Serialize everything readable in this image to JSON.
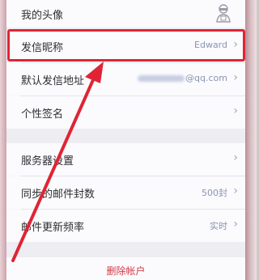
{
  "settings": {
    "avatar": {
      "label": "我的头像",
      "icon": "avatar-icon"
    },
    "sender_name": {
      "label": "发信昵称",
      "value": "Edward"
    },
    "default_address": {
      "label": "默认发信地址",
      "value": "@qq.com"
    },
    "signature": {
      "label": "个性签名"
    },
    "server": {
      "label": "服务器设置"
    },
    "sync_count": {
      "label": "同步的邮件封数",
      "value": "500封"
    },
    "update_freq": {
      "label": "邮件更新频率",
      "value": "实时"
    },
    "delete_account": {
      "label": "删除帐户"
    }
  },
  "colors": {
    "highlight": "#e02435",
    "value_text": "#8a93b4",
    "danger": "#d13a47"
  }
}
